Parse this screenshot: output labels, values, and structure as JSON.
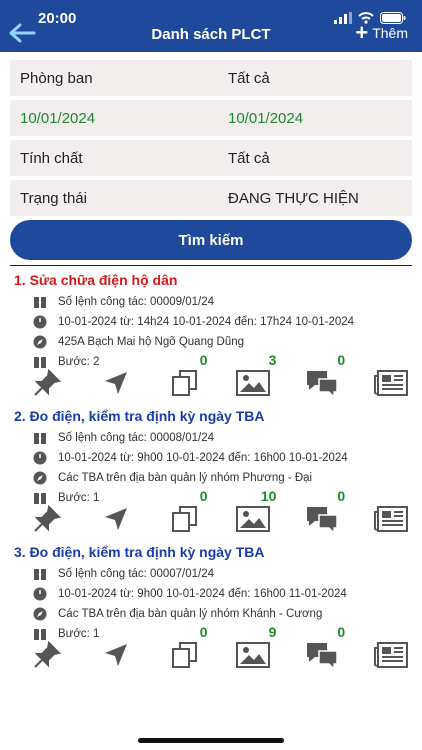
{
  "status": {
    "time": "20:00"
  },
  "header": {
    "title": "Danh sách PLCT",
    "add_label": "Thêm"
  },
  "filters": {
    "department": {
      "label": "Phòng ban",
      "value": "Tất cả"
    },
    "from_date": "10/01/2024",
    "to_date": "10/01/2024",
    "nature": {
      "label": "Tính chất",
      "value": "Tất cả"
    },
    "status": {
      "label": "Trạng thái",
      "value": "ĐANG THỰC HIỆN"
    }
  },
  "search_label": "Tìm kiếm",
  "items": [
    {
      "title": "1. Sửa chữa điện hộ dân",
      "order_no": "Số lệnh công tác: 00009/01/24",
      "time": "10-01-2024 từ: 14h24 10-01-2024 đến: 17h24 10-01-2024",
      "location": "425A Bạch Mai hộ Ngõ Quang Dũng",
      "step": "Bước: 2",
      "counts": {
        "copies": "0",
        "images": "3",
        "comments": "0"
      }
    },
    {
      "title": "2. Đo điện, kiểm tra định kỳ ngày TBA",
      "order_no": "Số lệnh công tác: 00008/01/24",
      "time": "10-01-2024 từ: 9h00 10-01-2024 đến: 16h00 10-01-2024",
      "location": "Các TBA trên địa bàn quản lý nhóm Phương - Đại",
      "step": "Bước: 1",
      "counts": {
        "copies": "0",
        "images": "10",
        "comments": "0"
      }
    },
    {
      "title": "3. Đo điện, kiểm tra định kỳ ngày TBA",
      "order_no": "Số lệnh công tác: 00007/01/24",
      "time": "10-01-2024 từ: 9h00 10-01-2024 đến: 16h00 11-01-2024",
      "location": "Các TBA trên địa bàn quản lý nhóm Khánh - Cương",
      "step": "Bước: 1",
      "counts": {
        "copies": "0",
        "images": "9",
        "comments": "0"
      }
    }
  ],
  "colors": {
    "primary": "#1f4a9c",
    "red_title": "#d11a1a",
    "blue_title": "#1a3da8",
    "green": "#1f8a2c"
  }
}
